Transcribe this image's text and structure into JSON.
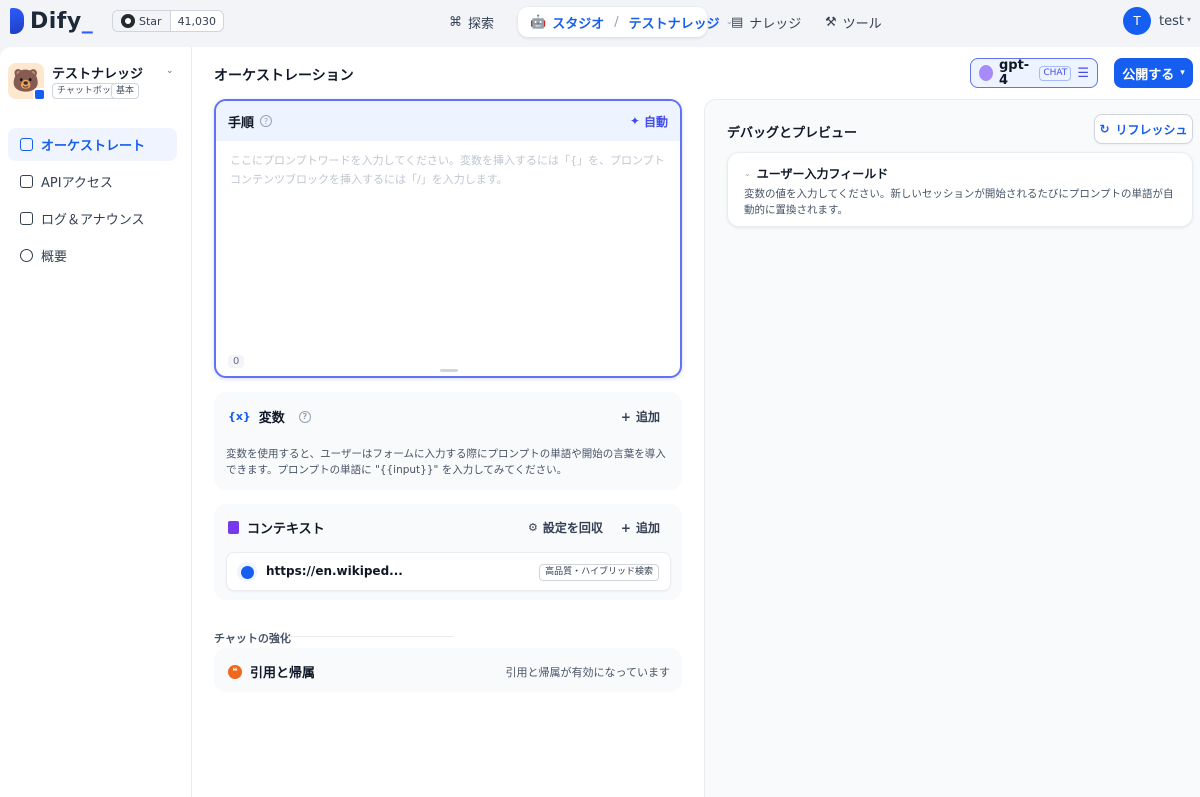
{
  "brand": {
    "name": "Dify",
    "underscore": "_"
  },
  "github": {
    "star_label": "Star",
    "count": "41,030"
  },
  "nav": {
    "explore": "探索",
    "studio": "スタジオ",
    "studio_app": "テストナレッジ",
    "knowledge": "ナレッジ",
    "tools": "ツール"
  },
  "user": {
    "initial": "T",
    "name": "test"
  },
  "app": {
    "name": "テストナレッジ",
    "tags": [
      "チャットボット",
      "基本"
    ]
  },
  "sidebar": {
    "items": [
      {
        "label": "オーケストレート"
      },
      {
        "label": "APIアクセス"
      },
      {
        "label": "ログ＆アナウンス"
      },
      {
        "label": "概要"
      }
    ]
  },
  "main": {
    "title": "オーケストレーション",
    "model": {
      "name": "gpt-4",
      "mode": "CHAT"
    },
    "publish_label": "公開する"
  },
  "prompt": {
    "title": "手順",
    "auto_label": "自動",
    "placeholder": "ここにプロンプトワードを入力してください。変数を挿入するには「{」を、プロンプトコンテンツブロックを挿入するには「/」を入力します。",
    "char_count": "0"
  },
  "variables": {
    "title": "変数",
    "add_label": "追加",
    "description": "変数を使用すると、ユーザーはフォームに入力する際にプロンプトの単語や開始の言葉を導入できます。プロンプトの単語に \"{{input}}\" を入力してみてください。"
  },
  "context": {
    "title": "コンテキスト",
    "recall_label": "設定を回収",
    "add_label": "追加",
    "item_url": "https://en.wikiped...",
    "item_tag": "高品質・ハイブリッド検索"
  },
  "enhancement": {
    "label": "チャットの強化",
    "citation_title": "引用と帰属",
    "citation_status": "引用と帰属が有効になっています"
  },
  "debug": {
    "title": "デバッグとプレビュー",
    "refresh_label": "リフレッシュ",
    "input_title": "ユーザー入力フィールド",
    "input_desc": "変数の値を入力してください。新しいセッションが開始されるたびにプロンプトの単語が自動的に置換されます。"
  },
  "icons": {
    "explore": "compass-icon",
    "studio": "robot-icon",
    "knowledge": "book-icon",
    "tools": "hammer-icon",
    "refresh": "refresh-icon"
  },
  "colors": {
    "accent": "#155eef",
    "prompt_border": "#6172f3",
    "citation": "#ef6820"
  }
}
